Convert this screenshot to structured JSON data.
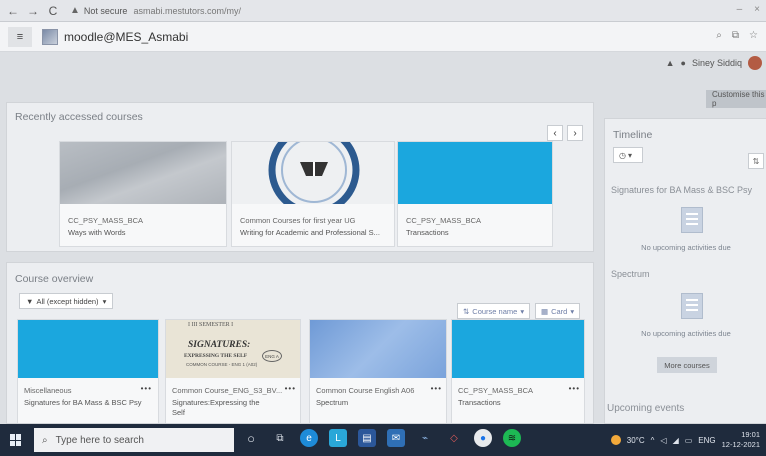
{
  "browser": {
    "warning": "Not secure",
    "url_host": "asmabi.mestutors.com/my/"
  },
  "header": {
    "site_name": "moodle@MES_Asmabi",
    "user_name": "Siney Siddiq"
  },
  "customise_label": "Customise this p",
  "recent": {
    "title": "Recently accessed courses",
    "cards": [
      {
        "category": "CC_PSY_MASS_BCA",
        "name": "Ways with Words"
      },
      {
        "category": "Common Courses for first year UG",
        "name": "Writing for Academic and Professional S..."
      },
      {
        "category": "CC_PSY_MASS_BCA",
        "name": "Transactions"
      }
    ]
  },
  "overview": {
    "title": "Course overview",
    "filter_label": "All (except hidden)",
    "sort_label": "Course name",
    "view_label": "Card",
    "cards": [
      {
        "category": "Miscellaneous",
        "name": "Signatures for BA Mass & BSC Psy"
      },
      {
        "category": "Common Course_ENG_S3_BV...",
        "name": "Signatures:Expressing the Self",
        "img_line1": "SIGNATURES:",
        "img_line2": "EXPRESSING THE SELF",
        "img_line3": "COMMON COURSE - ENG 1 (A02)",
        "img_top": "I III SEMESTER I",
        "img_badge": "ENG A"
      },
      {
        "category": "Common Course English A06",
        "name": "Spectrum"
      },
      {
        "category": "CC_PSY_MASS_BCA",
        "name": "Transactions"
      }
    ]
  },
  "timeline": {
    "title": "Timeline",
    "course1": "Signatures for BA Mass & BSC Psy",
    "no_upcoming": "No upcoming activities due",
    "course2": "Spectrum",
    "no_upcoming2": "No upcoming activities due",
    "more_courses": "More courses",
    "upcoming_events": "Upcoming events"
  },
  "taskbar": {
    "search_placeholder": "Type here to search",
    "temperature": "30°C",
    "lang": "ENG",
    "time": "19:01",
    "date": "12-12-2021"
  }
}
